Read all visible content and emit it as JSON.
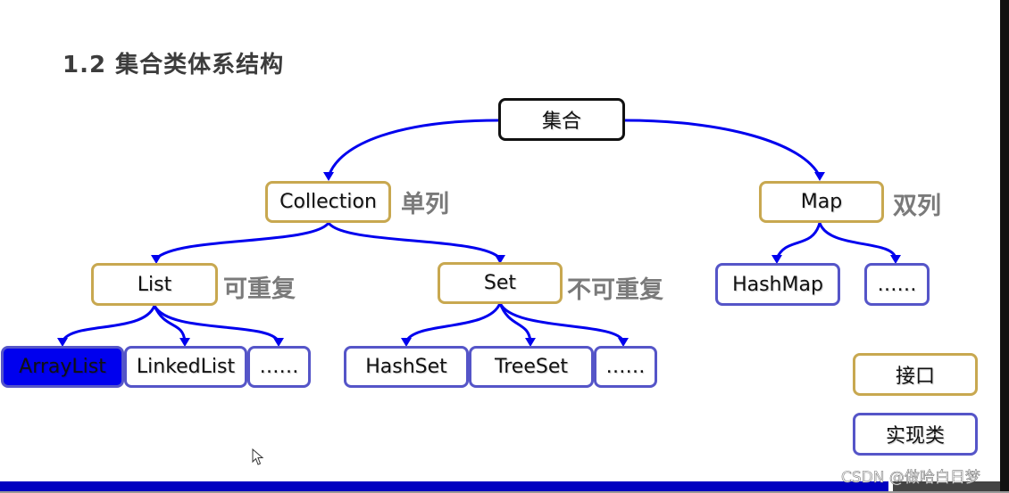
{
  "title": "1.2 集合类体系结构",
  "colors": {
    "edge": "#0000ee",
    "interface_border": "#c8a850",
    "implementation_border": "#5555c8",
    "root_border": "#111111",
    "note_text": "#7a7a7a",
    "selected_fill": "#0000ee"
  },
  "nodes": {
    "root": "集合",
    "collection": "Collection",
    "map": "Map",
    "list": "List",
    "set": "Set",
    "arraylist": "ArrayList",
    "linkedlist": "LinkedList",
    "list_more": "……",
    "hashset": "HashSet",
    "treeset": "TreeSet",
    "set_more": "……",
    "hashmap": "HashMap",
    "map_more": "……"
  },
  "notes": {
    "collection": "单列",
    "map": "双列",
    "list": "可重复",
    "set": "不可重复"
  },
  "legend": {
    "interface": "接口",
    "implementation": "实现类"
  },
  "watermark": "CSDN @做哈白日梦"
}
